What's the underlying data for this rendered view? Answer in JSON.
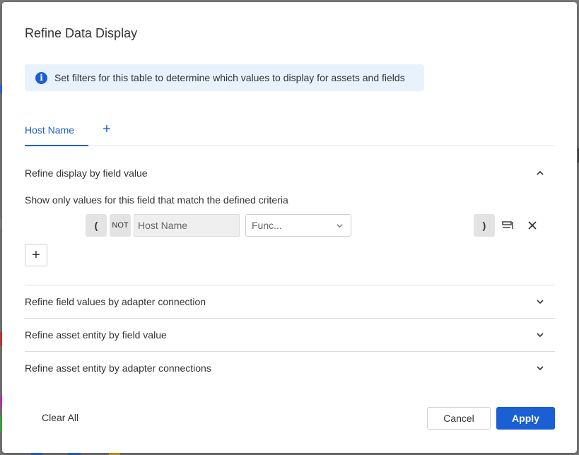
{
  "dialog": {
    "title": "Refine Data Display",
    "info_text": "Set filters for this table to determine which values to display for assets and fields"
  },
  "tabs": [
    {
      "label": "Host Name",
      "active": true
    }
  ],
  "sections": {
    "field_value": {
      "title": "Refine display by field value",
      "expanded": true,
      "description": "Show only values for this field that match the defined criteria"
    },
    "adapter_connection": {
      "title": "Refine field values by adapter connection",
      "expanded": false
    },
    "entity_field_value": {
      "title": "Refine asset entity by field value",
      "expanded": false
    },
    "entity_adapter_connections": {
      "title": "Refine asset entity by adapter connections",
      "expanded": false
    }
  },
  "rule": {
    "open_paren": "(",
    "not_label": "NOT",
    "field": "Host Name",
    "function_placeholder": "Func...",
    "close_paren": ")"
  },
  "footer": {
    "clear_all": "Clear All",
    "cancel": "Cancel",
    "apply": "Apply"
  },
  "icons": {
    "info": "info-icon",
    "add_tab": "plus-icon",
    "collapse": "chevron-up-icon",
    "expand": "chevron-down-icon",
    "rule_options": "list-options-icon",
    "remove_rule": "close-icon",
    "add_rule": "plus-icon"
  },
  "colors": {
    "accent": "#1a5fd3",
    "info_background": "#e8f2fc",
    "overlay": "#7d7d7d"
  }
}
